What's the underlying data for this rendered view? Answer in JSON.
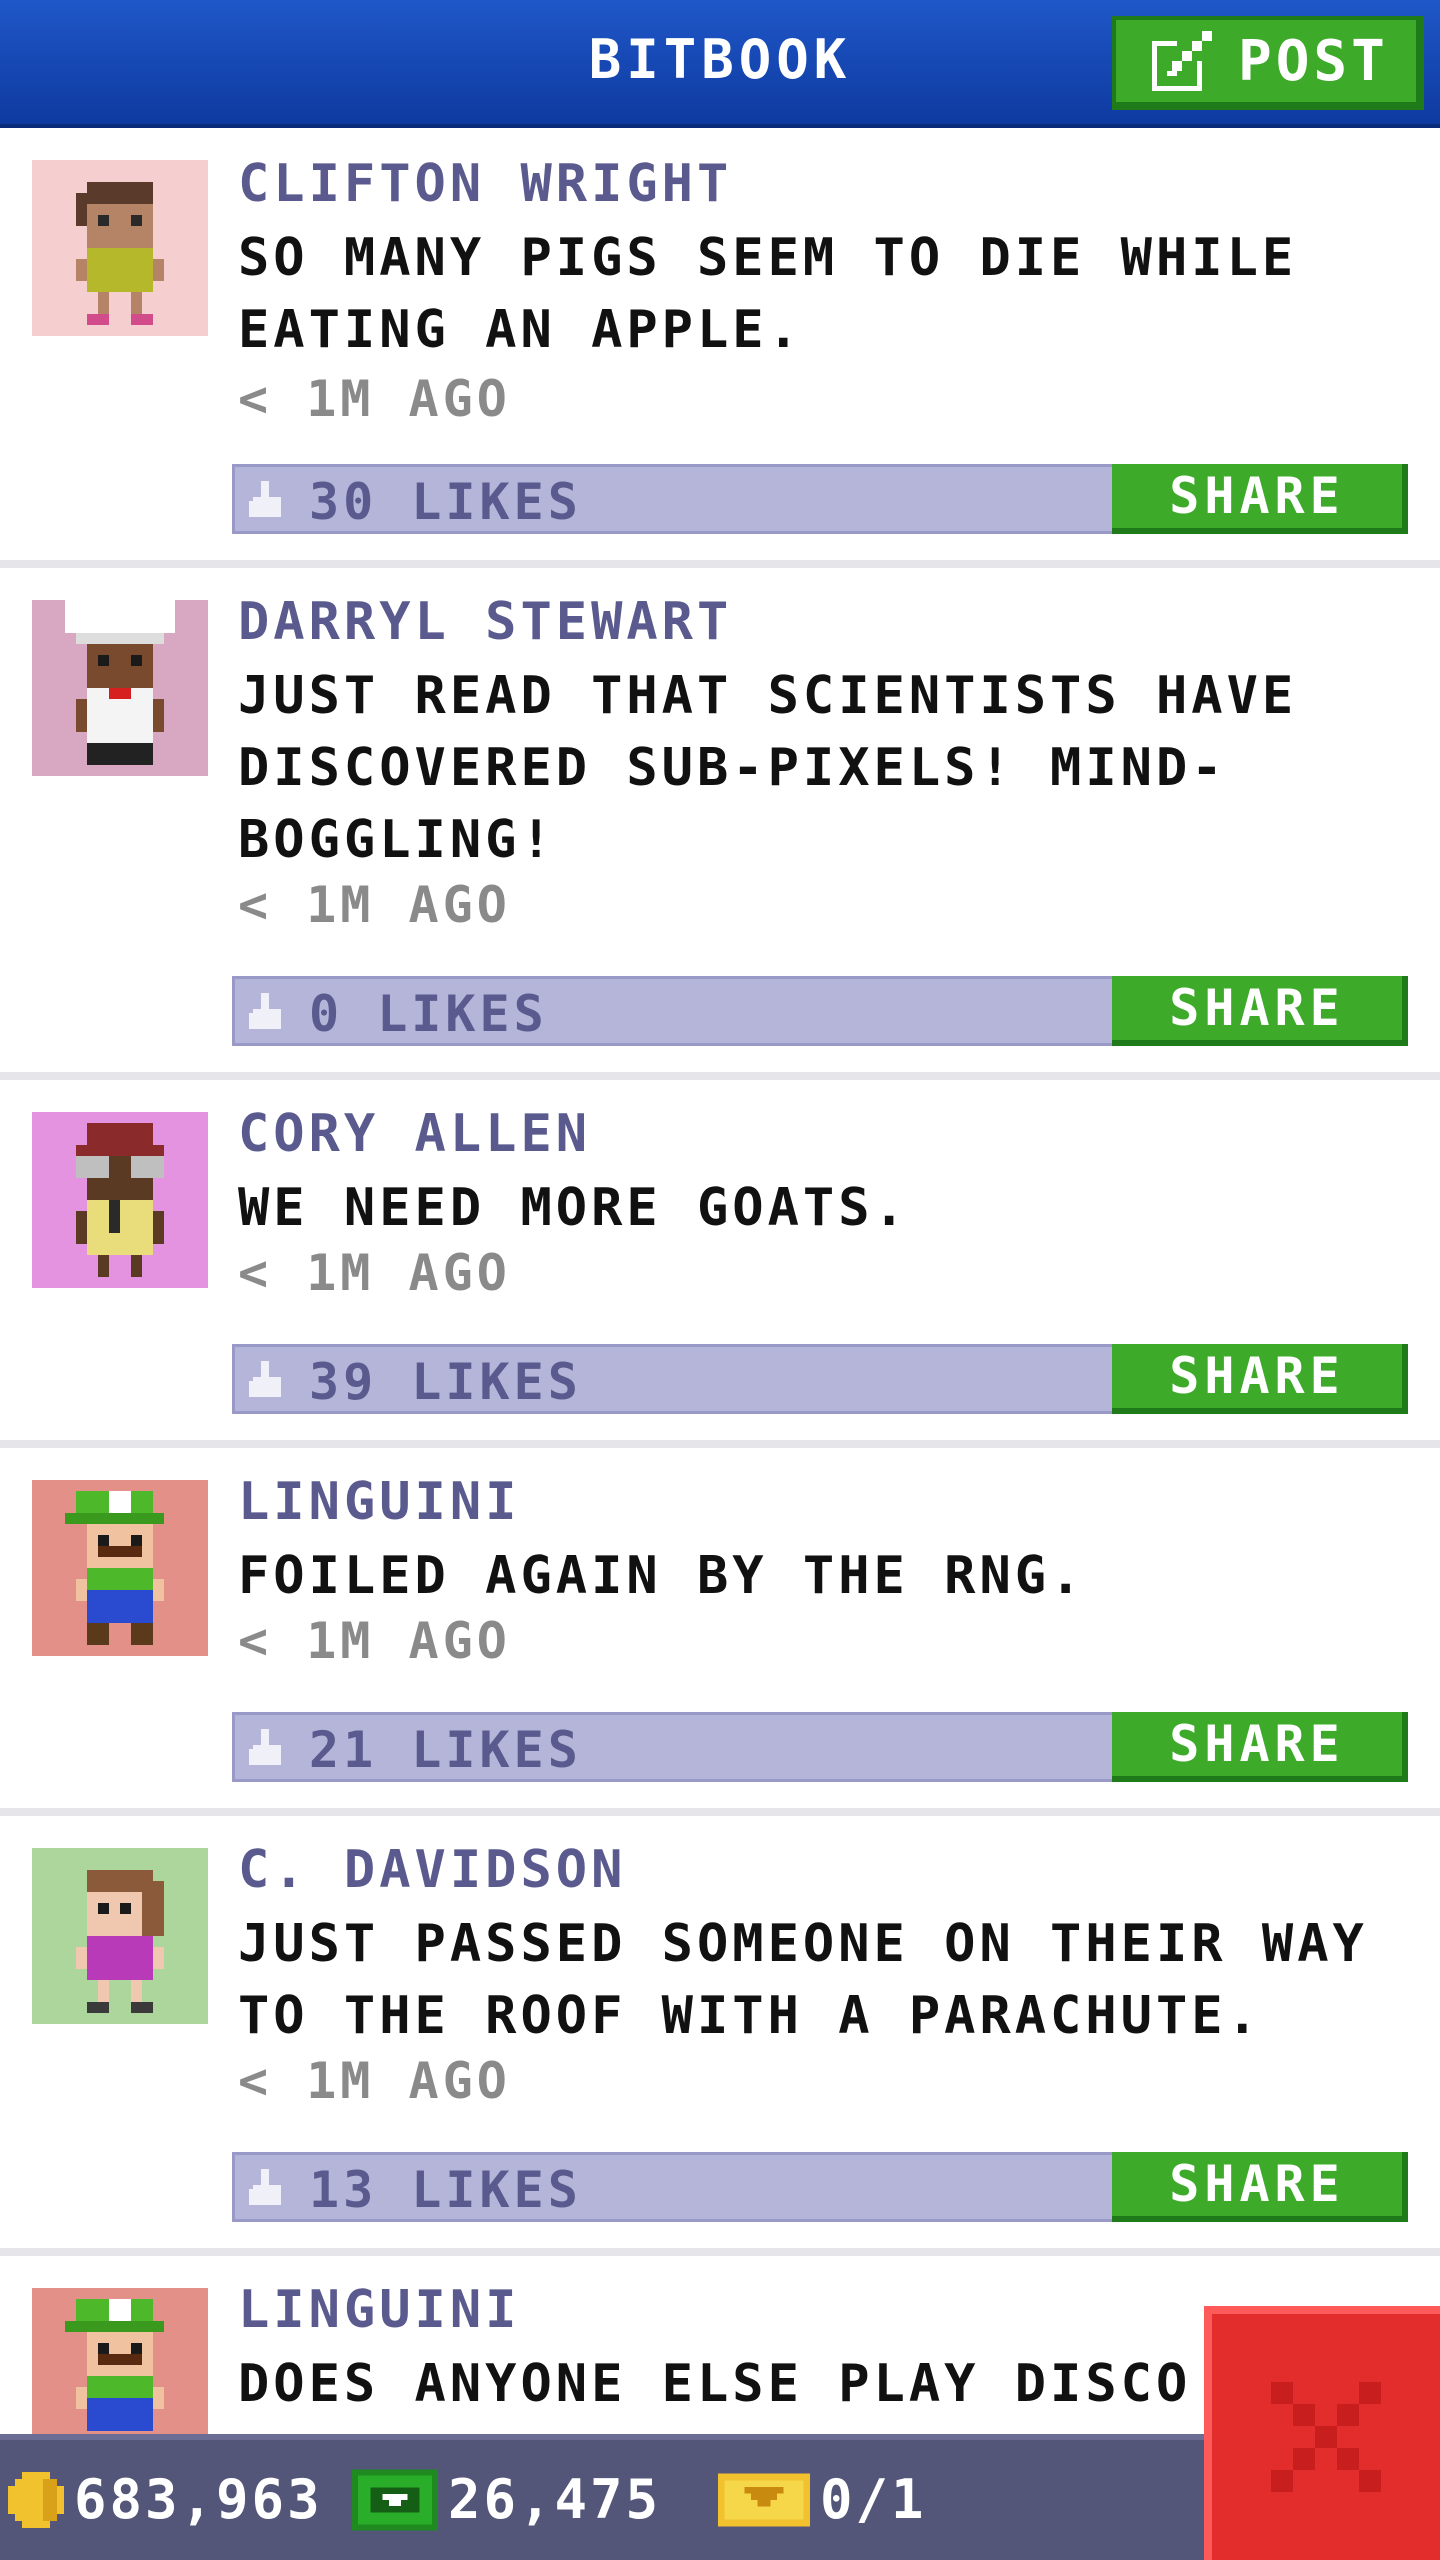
{
  "header": {
    "title": "BITBOOK",
    "post_label": "POST",
    "brand_blue": "#1f57c8",
    "accent_green": "#3daa2a"
  },
  "posts": [
    {
      "author": "CLIFTON WRIGHT",
      "message": "SO MANY PIGS SEEM TO DIE WHILE EATING AN APPLE.",
      "time": "< 1M AGO",
      "likes": "30 LIKES",
      "share_label": "SHARE",
      "avatar_bg": "#f5cfcf",
      "avatar": "woman-yellow-dress-avatar"
    },
    {
      "author": "DARRYL STEWART",
      "message": "JUST READ THAT SCIENTISTS HAVE DISCOVERED SUB-PIXELS! MIND-BOGGLING!",
      "time": "< 1M AGO",
      "likes": "0 LIKES",
      "share_label": "SHARE",
      "avatar_bg": "#d8a7c2",
      "avatar": "chef-avatar"
    },
    {
      "author": "CORY ALLEN",
      "message": "WE NEED MORE GOATS.",
      "time": "< 1M AGO",
      "likes": "39 LIKES",
      "share_label": "SHARE",
      "avatar_bg": "#e493e0",
      "avatar": "goggles-avatar"
    },
    {
      "author": "LINGUINI",
      "message": "FOILED AGAIN BY THE RNG.",
      "time": "< 1M AGO",
      "likes": "21 LIKES",
      "share_label": "SHARE",
      "avatar_bg": "#e39088",
      "avatar": "plumber-green-cap-avatar"
    },
    {
      "author": "C. DAVIDSON",
      "message": "JUST PASSED SOMEONE ON THEIR WAY TO THE ROOF WITH A PARACHUTE.",
      "time": "< 1M AGO",
      "likes": "13 LIKES",
      "share_label": "SHARE",
      "avatar_bg": "#acd69c",
      "avatar": "woman-purple-avatar"
    },
    {
      "author": "LINGUINI",
      "message": "DOES ANYONE ELSE PLAY DISCO",
      "avatar_bg": "#e39088",
      "avatar": "plumber-green-cap-avatar"
    }
  ],
  "status_bar": {
    "coins": "683,963",
    "bux": "26,475",
    "tickets": "0/1",
    "coin_icon": "coin-icon",
    "bux_icon": "cash-icon",
    "ticket_icon": "ticket-icon"
  },
  "close_icon": "close-icon"
}
